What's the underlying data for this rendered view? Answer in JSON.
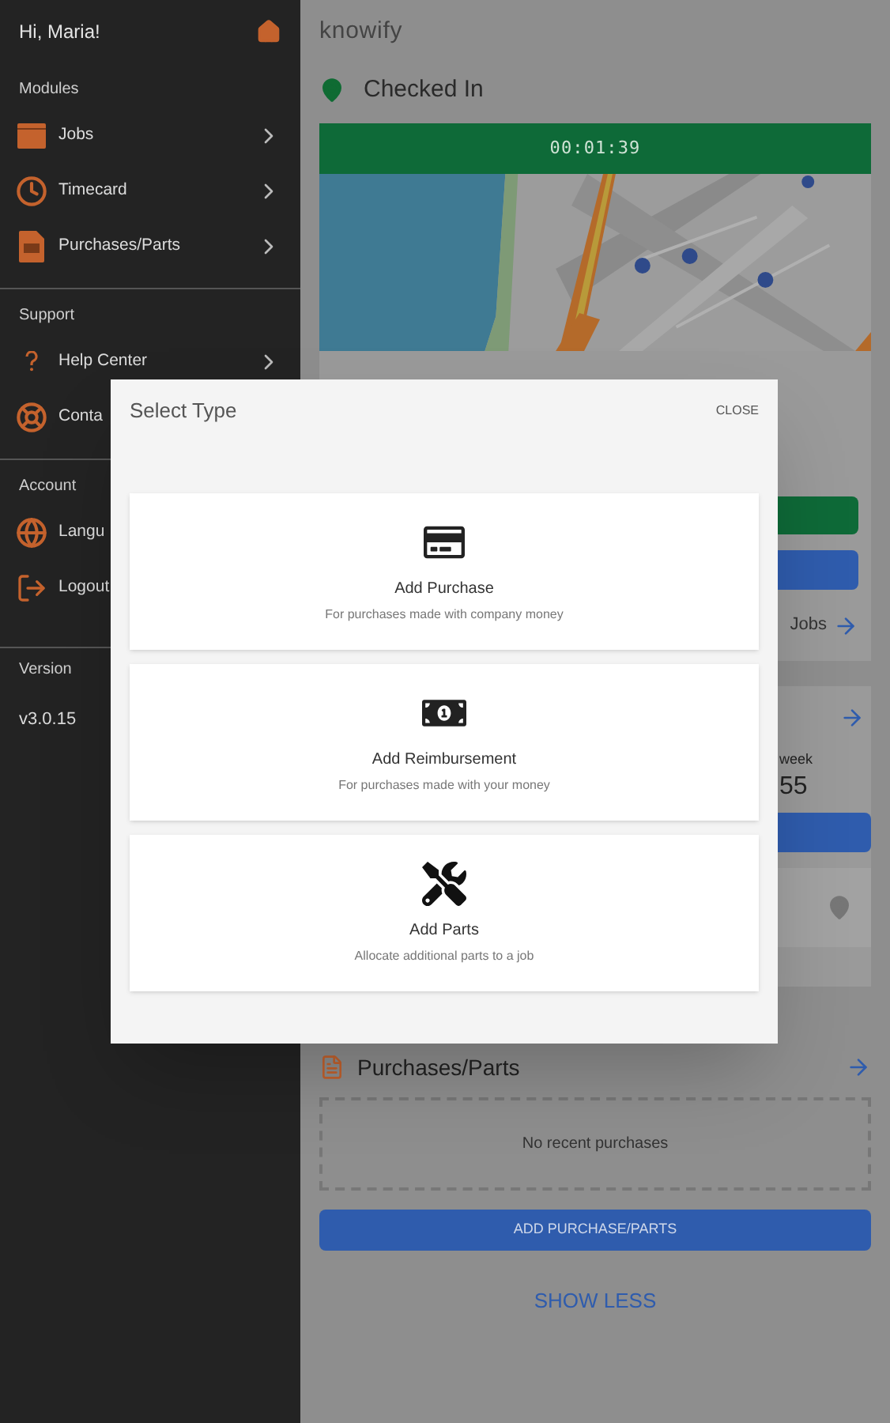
{
  "sidebar": {
    "greeting": "Hi, Maria!",
    "sections": [
      {
        "label": "Modules",
        "items": [
          {
            "label": "Jobs",
            "chevron": true
          },
          {
            "label": "Timecard",
            "chevron": true
          },
          {
            "label": "Purchases/Parts",
            "chevron": true
          }
        ]
      },
      {
        "label": "Support",
        "items": [
          {
            "label": "Help Center",
            "chevron": true
          },
          {
            "label": "Conta"
          }
        ]
      },
      {
        "label": "Account",
        "items": [
          {
            "label": "Langu"
          },
          {
            "label": "Logout"
          }
        ]
      }
    ],
    "version": {
      "label": "Version",
      "value": "v3.0.15"
    }
  },
  "main": {
    "logo": "knowify",
    "status": "Checked In",
    "timer": "00:01:39",
    "jobs_link": "Jobs",
    "week_label": "week",
    "week_value": "55",
    "purchases": {
      "title": "Purchases/Parts",
      "empty": "No recent purchases",
      "button": "ADD PURCHASE/PARTS"
    },
    "show_less": "SHOW LESS"
  },
  "dialog": {
    "title": "Select Type",
    "close": "CLOSE",
    "options": [
      {
        "title": "Add Purchase",
        "subtitle": "For purchases made with company money"
      },
      {
        "title": "Add Reimbursement",
        "subtitle": "For purchases made with your money"
      },
      {
        "title": "Add Parts",
        "subtitle": "Allocate additional parts to a job"
      }
    ]
  }
}
